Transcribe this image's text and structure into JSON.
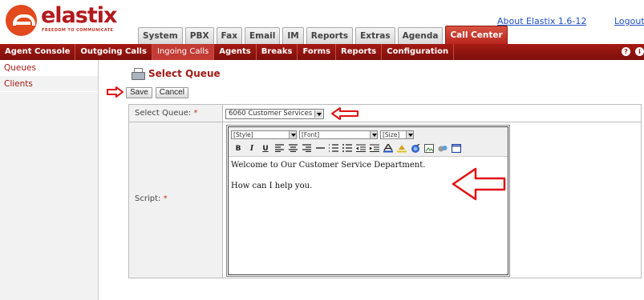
{
  "header": {
    "logo_text": "elastix",
    "logo_tagline": "FREEDOM TO COMMUNICATE",
    "about_link": "About Elastix 1.6-12",
    "logout_link": "Logout",
    "tabs": [
      {
        "label": "System"
      },
      {
        "label": "PBX"
      },
      {
        "label": "Fax"
      },
      {
        "label": "Email"
      },
      {
        "label": "IM"
      },
      {
        "label": "Reports"
      },
      {
        "label": "Extras"
      },
      {
        "label": "Agenda"
      },
      {
        "label": "Call Center",
        "active": true
      }
    ]
  },
  "subnav": {
    "items": [
      {
        "label": "Agent Console"
      },
      {
        "label": "Outgoing Calls"
      },
      {
        "label": "Ingoing Calls",
        "active": true
      },
      {
        "label": "Agents"
      },
      {
        "label": "Breaks"
      },
      {
        "label": "Forms"
      },
      {
        "label": "Reports"
      },
      {
        "label": "Configuration"
      }
    ]
  },
  "sidebar": {
    "items": [
      {
        "label": "Queues"
      },
      {
        "label": "Clients"
      }
    ]
  },
  "page": {
    "title": "Select Queue",
    "save_button": "Save",
    "cancel_button": "Cancel"
  },
  "form": {
    "select_queue_label": "Select Queue:",
    "required_mark": "*",
    "select_queue_value": "6060 Customer Services",
    "script_label": "Script:"
  },
  "editor": {
    "style_select": "[Style]",
    "font_select": "[Font]",
    "size_select": "[Size]",
    "line1": "Welcome to Our Customer Service Department.",
    "line2": "How can I help you."
  },
  "colors": {
    "brand_red": "#a51a14",
    "annotation_red": "#e01010",
    "link_blue": "#1f4fc0"
  }
}
